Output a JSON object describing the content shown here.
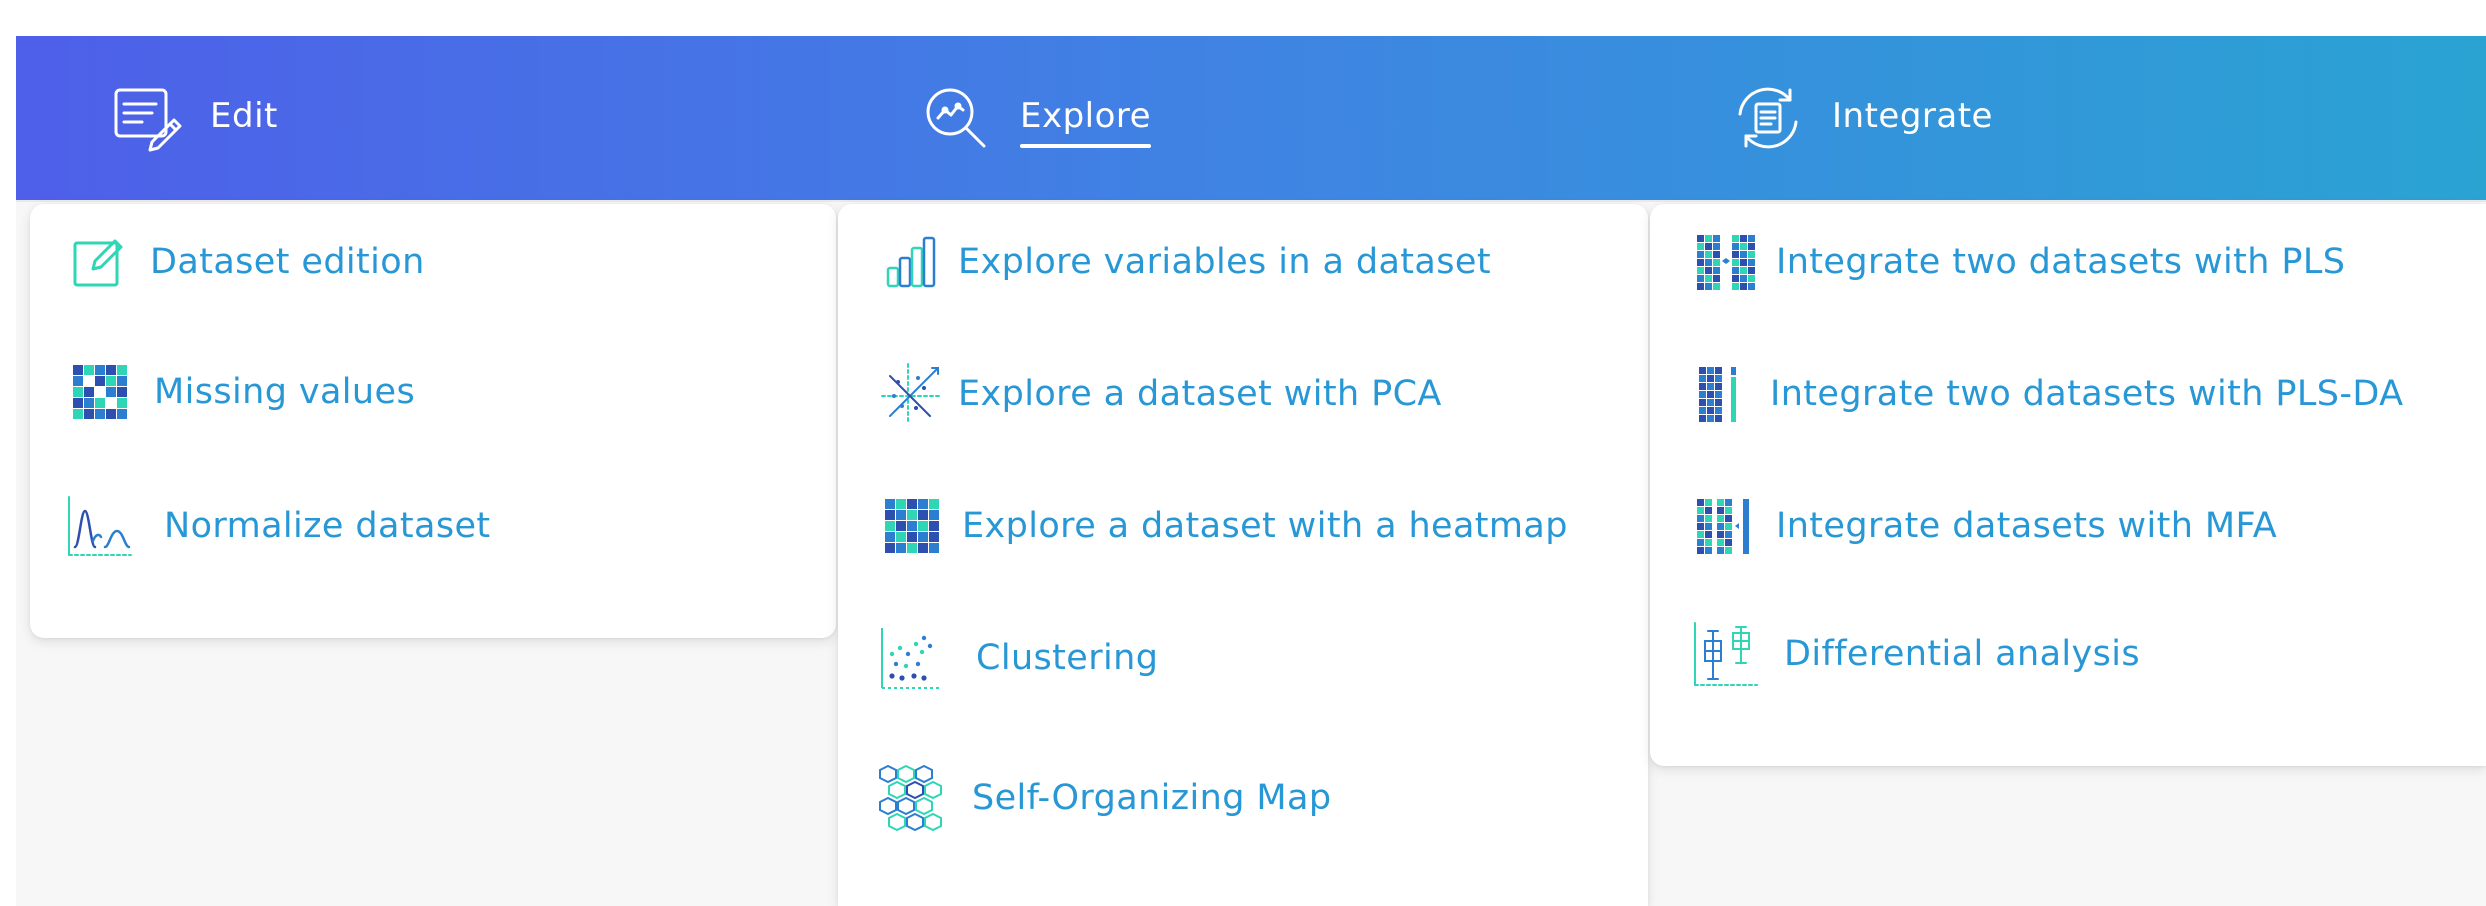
{
  "topnav": {
    "items": [
      {
        "id": "edit",
        "label": "Edit",
        "icon": "edit-document-icon",
        "active": false
      },
      {
        "id": "explore",
        "label": "Explore",
        "icon": "explore-magnifier-icon",
        "active": true
      },
      {
        "id": "integrate",
        "label": "Integrate",
        "icon": "integrate-sync-icon",
        "active": false
      }
    ]
  },
  "menus": {
    "edit": {
      "items": [
        {
          "label": "Dataset edition",
          "icon": "pencil-square-icon"
        },
        {
          "label": "Missing values",
          "icon": "grid-mosaic-icon"
        },
        {
          "label": "Normalize dataset",
          "icon": "distribution-curve-icon"
        }
      ]
    },
    "explore": {
      "items": [
        {
          "label": "Explore variables in a dataset",
          "icon": "bar-chart-icon"
        },
        {
          "label": "Explore a dataset with PCA",
          "icon": "pca-scatter-icon"
        },
        {
          "label": "Explore a dataset with a heatmap",
          "icon": "heatmap-grid-icon"
        },
        {
          "label": "Clustering",
          "icon": "cluster-dots-icon"
        },
        {
          "label": "Self-Organizing Map",
          "icon": "hexagon-map-icon"
        }
      ]
    },
    "integrate": {
      "items": [
        {
          "label": "Integrate two datasets with PLS",
          "icon": "pls-blocks-icon"
        },
        {
          "label": "Integrate two datasets with PLS-DA",
          "icon": "plsda-blocks-icon"
        },
        {
          "label": "Integrate datasets with MFA",
          "icon": "mfa-blocks-icon"
        },
        {
          "label": "Differential analysis",
          "icon": "boxplot-icon"
        }
      ]
    }
  },
  "colors": {
    "gradient_start": "#4e5fe9",
    "gradient_end": "#2aa3d3",
    "menu_text": "#2897d5",
    "icon_teal": "#2fd6b6",
    "icon_blue": "#2c7fd0",
    "icon_navy": "#2c4fb0"
  }
}
